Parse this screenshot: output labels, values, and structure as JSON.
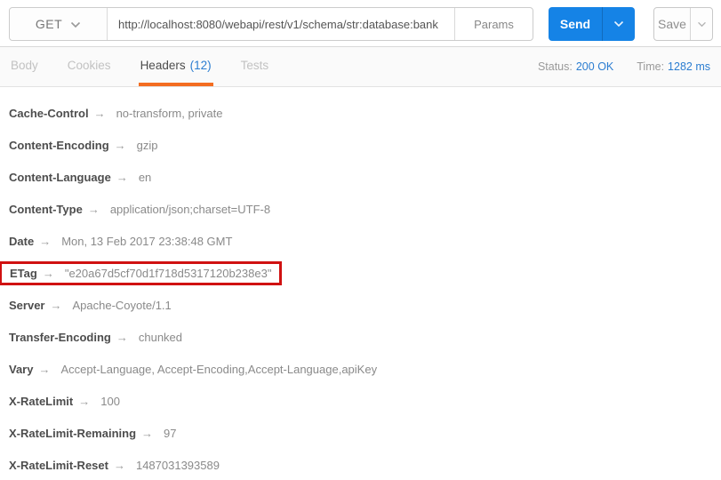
{
  "request_bar": {
    "method": "GET",
    "url": "http://localhost:8080/webapi/rest/v1/schema/str:database:bank",
    "params_label": "Params",
    "send_label": "Send",
    "save_label": "Save"
  },
  "tabs": {
    "body": "Body",
    "cookies": "Cookies",
    "headers": "Headers",
    "headers_count": "(12)",
    "tests": "Tests"
  },
  "status": {
    "status_label": "Status:",
    "status_value": "200 OK",
    "time_label": "Time:",
    "time_value": "1282 ms"
  },
  "ui": {
    "arrow": "→"
  },
  "colors": {
    "accent_orange": "#f36d21",
    "send_blue": "#1583e6",
    "link_blue": "#2b7dd1",
    "highlight_red": "#d01111"
  },
  "response_headers": [
    {
      "name": "Cache-Control",
      "value": "no-transform, private"
    },
    {
      "name": "Content-Encoding",
      "value": "gzip"
    },
    {
      "name": "Content-Language",
      "value": "en"
    },
    {
      "name": "Content-Type",
      "value": "application/json;charset=UTF-8"
    },
    {
      "name": "Date",
      "value": "Mon, 13 Feb 2017 23:38:48 GMT"
    },
    {
      "name": "ETag",
      "value": "\"e20a67d5cf70d1f718d5317120b238e3\"",
      "highlighted": true
    },
    {
      "name": "Server",
      "value": "Apache-Coyote/1.1"
    },
    {
      "name": "Transfer-Encoding",
      "value": "chunked"
    },
    {
      "name": "Vary",
      "value": "Accept-Language, Accept-Encoding,Accept-Language,apiKey"
    },
    {
      "name": "X-RateLimit",
      "value": "100"
    },
    {
      "name": "X-RateLimit-Remaining",
      "value": "97"
    },
    {
      "name": "X-RateLimit-Reset",
      "value": "1487031393589"
    }
  ]
}
